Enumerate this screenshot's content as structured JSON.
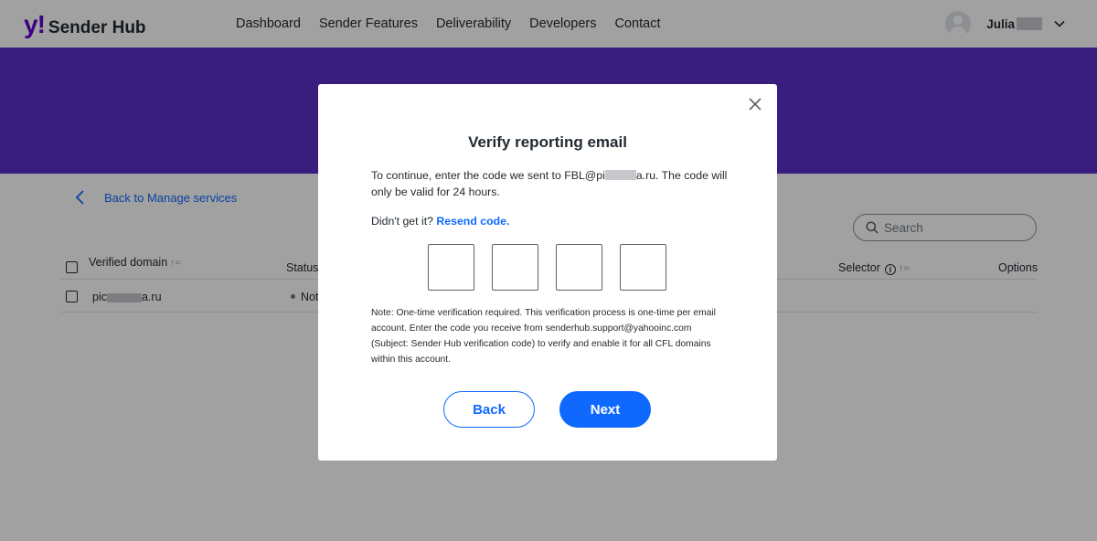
{
  "header": {
    "logo_mark": "y!",
    "logo_text": "Sender Hub",
    "nav": [
      {
        "label": "Dashboard"
      },
      {
        "label": "Sender Features"
      },
      {
        "label": "Deliverability"
      },
      {
        "label": "Developers"
      },
      {
        "label": "Contact"
      }
    ],
    "user_name": "Julia",
    "icons": {
      "avatar": "user-avatar-icon",
      "menu": "chevron-down-icon"
    }
  },
  "page": {
    "back_label": "Back to Manage services",
    "search_placeholder": "Search",
    "table": {
      "columns": {
        "domain": "Verified domain",
        "status": "Status",
        "selector": "Selector",
        "options": "Options"
      },
      "rows": [
        {
          "domain_prefix": "pic",
          "domain_suffix": "a.ru",
          "status": "Not"
        }
      ]
    }
  },
  "modal": {
    "title": "Verify reporting email",
    "desc_before": "To continue, enter the code we sent to FBL@pi",
    "desc_after": "a.ru. The code will only be valid for 24 hours.",
    "resend_prompt": "Didn't get it?",
    "resend_link": "Resend code.",
    "code_length": 4,
    "note": "Note: One-time verification required. This verification process is one-time per email account. Enter the code you receive from senderhub.support@yahooinc.com (Subject: Sender Hub verification code) to verify and enable it for all CFL domains within this account.",
    "back_button": "Back",
    "next_button": "Next"
  },
  "colors": {
    "brand_purple": "#6001d2",
    "hero_purple": "#5b2fc9",
    "link_blue": "#0f69ff"
  }
}
